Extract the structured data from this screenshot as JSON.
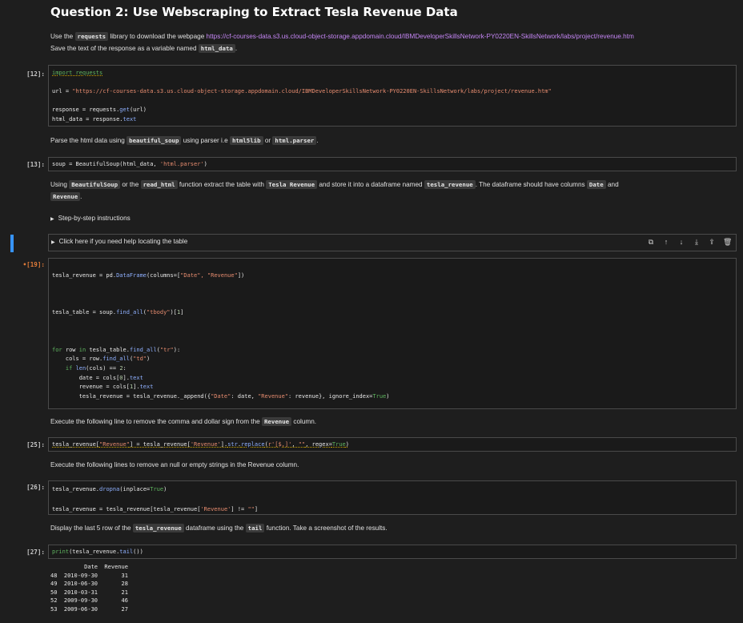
{
  "heading": "Question 2: Use Webscraping to Extract Tesla Revenue Data",
  "md1": {
    "a": "Use the ",
    "code1": "requests",
    "b": " library to download the webpage ",
    "link": "https://cf-courses-data.s3.us.cloud-object-storage.appdomain.cloud/IBMDeveloperSkillsNetwork-PY0220EN-SkillsNetwork/labs/project/revenue.htm",
    "c": "Save the text of the response as a variable named ",
    "code2": "html_data",
    "d": "."
  },
  "cell12": {
    "prompt": "[12]:",
    "l1": "import requests",
    "l2a": "url = ",
    "l2b": "\"https://cf-courses-data.s3.us.cloud-object-storage.appdomain.cloud/IBMDeveloperSkillsNetwork-PY0220EN-SkillsNetwork/labs/project/revenue.htm\"",
    "l3a": "response = requests.",
    "l3b": "get",
    "l3c": "(url)",
    "l4a": "html_data = response.",
    "l4b": "text"
  },
  "md2": {
    "a": "Parse the html data using ",
    "code1": "beautiful_soup",
    "b": " using parser i.e ",
    "code2": "html5lib",
    "c": " or ",
    "code3": "html.parser",
    "d": "."
  },
  "cell13": {
    "prompt": "[13]:",
    "a": "soup = BeautifulSoup(html_data, ",
    "b": "'html.parser'",
    "c": ")"
  },
  "md3": {
    "a": "Using ",
    "code1": "BeautifulSoup",
    "b": " or the ",
    "code2": "read_html",
    "c": " function extract the table with ",
    "code3": "Tesla Revenue",
    "d": " and store it into a dataframe named ",
    "code4": "tesla_revenue",
    "e": ". The dataframe should have columns ",
    "code5": "Date",
    "f": " and ",
    "code6": "Revenue",
    "g": "."
  },
  "collapse1": "Step-by-step instructions",
  "collapse2": "Click here if you need help locating the table",
  "toolbar": [
    "⧉",
    "↑",
    "↓",
    "⤓",
    "⇪",
    "🗑"
  ],
  "cell19": {
    "prompt": "•[19]:",
    "l1a": "tesla_revenue = pd.",
    "l1b": "DataFrame",
    "l1c": "(columns=[",
    "l1d": "\"Date\", \"Revenue\"",
    "l1e": "])",
    "l2a": "tesla_table = soup.",
    "l2b": "find_all",
    "l2c": "(",
    "l2d": "\"tbody\"",
    "l2e": ")[",
    "l2f": "1",
    "l2g": "]",
    "l3a": "for",
    "l3b": " row ",
    "l3c": "in",
    "l3d": " tesla_table.",
    "l3e": "find_all",
    "l3f": "(",
    "l3g": "\"tr\"",
    "l3h": "):",
    "l4a": "    cols = row.",
    "l4b": "find_all",
    "l4c": "(",
    "l4d": "\"td\"",
    "l4e": ")",
    "l5a": "    ",
    "l5b": "if",
    "l5c": " ",
    "l5d": "len",
    "l5e": "(cols) == ",
    "l5f": "2",
    "l5g": ":",
    "l6a": "        date = cols[",
    "l6b": "0",
    "l6c": "].",
    "l6d": "text",
    "l7a": "        revenue = cols[",
    "l7b": "1",
    "l7c": "].",
    "l7d": "text",
    "l8a": "        tesla_revenue = tesla_revenue._append({",
    "l8b": "\"Date\"",
    "l8c": ": date, ",
    "l8d": "\"Revenue\"",
    "l8e": ": revenue}, ignore_index=",
    "l8f": "True",
    "l8g": ")"
  },
  "md4": {
    "a": "Execute the following line to remove the comma and dollar sign from the ",
    "code1": "Revenue",
    "b": " column."
  },
  "cell25": {
    "prompt": "[25]:",
    "a": "tesla_revenue[",
    "b": "\"Revenue\"",
    "c": "] = tesla_revenue[",
    "d": "'Revenue'",
    "e": "].",
    "f": "str",
    "g": ".",
    "h": "replace",
    "i": "(",
    "j": "r'[$,]'",
    "k": ", ",
    "l": "\"\"",
    "m": ", regex=",
    "n": "True",
    "o": ")"
  },
  "md5": "Execute the following lines to remove an null or empty strings in the Revenue column.",
  "cell26": {
    "prompt": "[26]:",
    "l1a": "tesla_revenue.",
    "l1b": "dropna",
    "l1c": "(inplace=",
    "l1d": "True",
    "l1e": ")",
    "l2a": "tesla_revenue = tesla_revenue[tesla_revenue[",
    "l2b": "'Revenue'",
    "l2c": "] != ",
    "l2d": "\"\"",
    "l2e": "]"
  },
  "md6": {
    "a": "Display the last 5 row of the ",
    "code1": "tesla_revenue",
    "b": " dataframe using the ",
    "code2": "tail",
    "c": " function. Take a screenshot of the results."
  },
  "cell27": {
    "prompt": "[27]:",
    "a": "print",
    "b": "(tesla_revenue.",
    "c": "tail",
    "d": "())"
  },
  "output27": {
    "header": "          Date  Revenue",
    "rows": [
      "48  2010-09-30       31",
      "49  2010-06-30       28",
      "50  2010-03-31       21",
      "52  2009-09-30       46",
      "53  2009-06-30       27"
    ]
  }
}
